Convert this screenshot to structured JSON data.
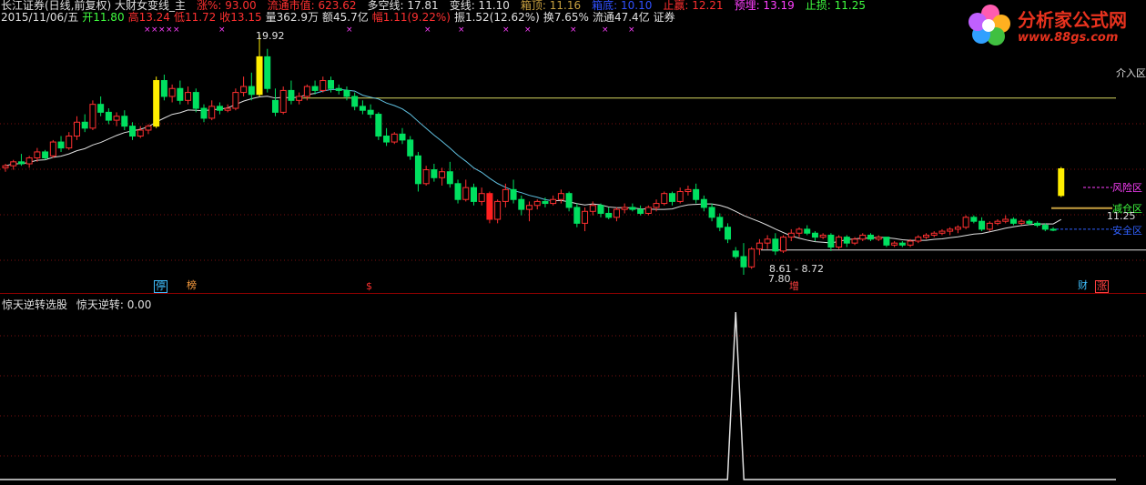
{
  "header": {
    "line1": [
      {
        "text": "长江证券(日线,前复权) 大财女变线_主",
        "color": "#e0e0e0"
      },
      {
        "text": "涨%: 93.00",
        "color": "#ff3030"
      },
      {
        "text": "流通市值: 623.62",
        "color": "#ff3030"
      },
      {
        "text": "多空线: 17.81",
        "color": "#e0e0e0"
      },
      {
        "text": "变线: 11.10",
        "color": "#e0e0e0"
      },
      {
        "text": "箱顶: 11.16",
        "color": "#c8a040"
      },
      {
        "text": "箱底: 10.10",
        "color": "#3050ff"
      },
      {
        "text": "止赢: 12.21",
        "color": "#ff3030"
      },
      {
        "text": "预埋: 13.19",
        "color": "#ff40ff"
      },
      {
        "text": "止损: 11.25",
        "color": "#40ff40"
      }
    ],
    "line2": [
      {
        "text": "2015/11/06/五",
        "color": "#e0e0e0"
      },
      {
        "text": "开11.80",
        "color": "#40ff40"
      },
      {
        "text": "高13.24",
        "color": "#ff3030"
      },
      {
        "text": "低11.72",
        "color": "#ff3030"
      },
      {
        "text": "收13.15",
        "color": "#ff3030"
      },
      {
        "text": "量362.9万",
        "color": "#e0e0e0"
      },
      {
        "text": "额45.7亿",
        "color": "#e0e0e0"
      },
      {
        "text": "幅1.11(9.22%)",
        "color": "#ff3030"
      },
      {
        "text": "振1.52(12.62%)",
        "color": "#e0e0e0"
      },
      {
        "text": "换7.65%",
        "color": "#e0e0e0"
      },
      {
        "text": "流通47.4亿",
        "color": "#e0e0e0"
      },
      {
        "text": "证券",
        "color": "#e0e0e0"
      }
    ]
  },
  "logo": {
    "title": "分析家公式网",
    "url": "www.88gs.com"
  },
  "annotations": {
    "high_label": "19.92",
    "low_label": "7.80",
    "range_label": "8.61 - 8.72",
    "entry_label": "介入区",
    "risk_label": "风险区",
    "sell_label": "减仓区",
    "safe_label": "安全区",
    "price_tag": "11.25"
  },
  "tags": [
    {
      "text": "停",
      "color": "#40c0ff"
    },
    {
      "text": "榜",
      "color": "#ffa040"
    },
    {
      "text": "$",
      "color": "#ff3030"
    },
    {
      "text": "增",
      "color": "#ff4040"
    },
    {
      "text": "财",
      "color": "#40c0ff"
    },
    {
      "text": "涨",
      "color": "#ff4040"
    }
  ],
  "sub_panel": {
    "title": "惊天逆转选股",
    "value_label": "惊天逆转: 0.00"
  },
  "chart_data": {
    "type": "candlestick",
    "price_range": [
      7.8,
      19.92
    ],
    "candles": [
      [
        13.2,
        13.4,
        13.0,
        13.3
      ],
      [
        13.3,
        13.6,
        13.1,
        13.5
      ],
      [
        13.5,
        13.9,
        13.3,
        13.4
      ],
      [
        13.4,
        13.8,
        13.2,
        13.7
      ],
      [
        13.7,
        14.2,
        13.5,
        14.0
      ],
      [
        14.0,
        14.1,
        13.6,
        13.7
      ],
      [
        13.8,
        14.6,
        13.7,
        14.5
      ],
      [
        14.5,
        14.8,
        14.0,
        14.2
      ],
      [
        14.2,
        15.0,
        14.1,
        14.8
      ],
      [
        14.8,
        15.8,
        14.6,
        15.5
      ],
      [
        15.5,
        15.9,
        15.0,
        15.2
      ],
      [
        15.2,
        16.6,
        15.1,
        16.4
      ],
      [
        16.4,
        16.8,
        15.8,
        16.0
      ],
      [
        16.0,
        16.2,
        15.4,
        15.6
      ],
      [
        15.6,
        16.0,
        15.3,
        15.8
      ],
      [
        15.8,
        16.1,
        15.1,
        15.3
      ],
      [
        15.3,
        15.5,
        14.6,
        14.8
      ],
      [
        14.8,
        15.3,
        14.7,
        15.1
      ],
      [
        15.1,
        15.4,
        14.9,
        15.3
      ],
      [
        15.3,
        17.8,
        15.2,
        17.6
      ],
      [
        17.6,
        17.9,
        16.6,
        16.8
      ],
      [
        16.8,
        17.4,
        16.5,
        17.2
      ],
      [
        17.2,
        17.6,
        16.4,
        16.6
      ],
      [
        16.6,
        17.3,
        16.4,
        17.0
      ],
      [
        17.0,
        17.2,
        16.0,
        16.2
      ],
      [
        16.2,
        16.4,
        15.5,
        15.7
      ],
      [
        15.7,
        16.6,
        15.6,
        16.3
      ],
      [
        16.3,
        16.5,
        15.9,
        16.1
      ],
      [
        16.1,
        16.4,
        16.0,
        16.2
      ],
      [
        16.2,
        17.2,
        16.1,
        17.0
      ],
      [
        17.0,
        17.8,
        16.8,
        17.3
      ],
      [
        17.3,
        18.0,
        16.6,
        16.9
      ],
      [
        16.9,
        19.92,
        16.8,
        18.8
      ],
      [
        18.8,
        19.2,
        17.0,
        17.2
      ],
      [
        16.6,
        17.2,
        15.8,
        16.0
      ],
      [
        16.0,
        17.3,
        15.9,
        17.1
      ],
      [
        17.1,
        17.6,
        16.4,
        16.6
      ],
      [
        16.6,
        17.0,
        16.4,
        16.8
      ],
      [
        16.8,
        17.4,
        16.6,
        17.3
      ],
      [
        17.3,
        17.6,
        16.9,
        17.1
      ],
      [
        17.1,
        17.8,
        17.0,
        17.6
      ],
      [
        17.6,
        17.8,
        17.0,
        17.2
      ],
      [
        17.2,
        17.4,
        16.9,
        17.1
      ],
      [
        17.1,
        17.3,
        16.6,
        16.8
      ],
      [
        16.8,
        17.0,
        16.1,
        16.3
      ],
      [
        16.3,
        16.6,
        15.9,
        16.1
      ],
      [
        16.1,
        16.4,
        15.7,
        15.9
      ],
      [
        15.9,
        16.0,
        14.6,
        14.8
      ],
      [
        14.8,
        15.2,
        14.3,
        14.5
      ],
      [
        14.5,
        15.0,
        14.4,
        14.9
      ],
      [
        14.9,
        15.2,
        14.4,
        14.6
      ],
      [
        14.6,
        14.8,
        13.6,
        13.8
      ],
      [
        13.8,
        14.0,
        12.0,
        12.4
      ],
      [
        12.4,
        13.3,
        12.3,
        13.1
      ],
      [
        13.1,
        13.4,
        12.5,
        12.7
      ],
      [
        12.7,
        13.2,
        12.3,
        13.0
      ],
      [
        13.0,
        13.5,
        12.2,
        12.4
      ],
      [
        12.4,
        12.6,
        11.4,
        11.6
      ],
      [
        11.6,
        12.6,
        11.5,
        12.2
      ],
      [
        12.2,
        12.4,
        11.3,
        11.5
      ],
      [
        11.5,
        12.2,
        11.3,
        11.9
      ],
      [
        11.9,
        12.0,
        10.4,
        10.6
      ],
      [
        10.6,
        11.6,
        10.4,
        11.5
      ],
      [
        11.5,
        12.4,
        11.2,
        12.1
      ],
      [
        12.1,
        12.6,
        11.4,
        11.6
      ],
      [
        11.6,
        11.8,
        10.8,
        11.1
      ],
      [
        11.1,
        11.5,
        10.5,
        11.3
      ],
      [
        11.3,
        11.6,
        11.1,
        11.5
      ],
      [
        11.5,
        11.7,
        11.2,
        11.4
      ],
      [
        11.4,
        11.8,
        11.3,
        11.6
      ],
      [
        11.6,
        12.1,
        11.4,
        11.9
      ],
      [
        11.9,
        12.0,
        11.0,
        11.2
      ],
      [
        11.2,
        11.4,
        10.2,
        10.4
      ],
      [
        10.4,
        11.2,
        10.0,
        11.0
      ],
      [
        11.0,
        11.5,
        10.8,
        11.3
      ],
      [
        11.3,
        11.4,
        10.7,
        10.9
      ],
      [
        10.9,
        11.2,
        10.6,
        10.7
      ],
      [
        10.7,
        11.2,
        10.5,
        11.1
      ],
      [
        11.1,
        11.4,
        10.9,
        11.2
      ],
      [
        11.2,
        11.4,
        11.0,
        11.1
      ],
      [
        11.1,
        11.3,
        10.8,
        10.9
      ],
      [
        10.9,
        11.3,
        10.8,
        11.2
      ],
      [
        11.2,
        11.6,
        11.0,
        11.4
      ],
      [
        11.4,
        12.0,
        11.3,
        11.9
      ],
      [
        11.9,
        12.0,
        11.3,
        11.5
      ],
      [
        11.5,
        12.2,
        11.4,
        12.0
      ],
      [
        12.0,
        12.3,
        11.8,
        12.1
      ],
      [
        12.1,
        12.4,
        11.4,
        11.6
      ],
      [
        11.6,
        11.8,
        11.0,
        11.2
      ],
      [
        11.2,
        11.4,
        10.5,
        10.7
      ],
      [
        10.7,
        10.9,
        10.0,
        10.2
      ],
      [
        10.2,
        10.4,
        9.4,
        9.6
      ],
      [
        9.0,
        9.2,
        8.61,
        8.72
      ],
      [
        8.72,
        9.4,
        7.8,
        8.2
      ],
      [
        8.2,
        9.2,
        8.1,
        9.1
      ],
      [
        9.1,
        9.6,
        8.8,
        9.4
      ],
      [
        9.4,
        9.8,
        9.1,
        9.6
      ],
      [
        9.6,
        9.9,
        8.8,
        9.0
      ],
      [
        9.0,
        9.8,
        8.9,
        9.7
      ],
      [
        9.7,
        10.1,
        9.5,
        9.9
      ],
      [
        9.9,
        10.2,
        9.7,
        10.1
      ],
      [
        10.1,
        10.3,
        9.8,
        9.9
      ],
      [
        9.9,
        10.0,
        9.5,
        9.7
      ],
      [
        9.7,
        9.9,
        9.6,
        9.8
      ],
      [
        9.8,
        9.9,
        9.0,
        9.2
      ],
      [
        9.2,
        9.8,
        9.1,
        9.7
      ],
      [
        9.7,
        9.8,
        9.2,
        9.4
      ],
      [
        9.4,
        9.7,
        9.3,
        9.6
      ],
      [
        9.6,
        9.9,
        9.5,
        9.8
      ],
      [
        9.8,
        9.9,
        9.5,
        9.6
      ],
      [
        9.6,
        9.8,
        9.5,
        9.7
      ],
      [
        9.7,
        9.7,
        9.2,
        9.3
      ],
      [
        9.3,
        9.5,
        9.2,
        9.4
      ],
      [
        9.4,
        9.5,
        9.2,
        9.3
      ],
      [
        9.3,
        9.6,
        9.2,
        9.5
      ],
      [
        9.5,
        9.8,
        9.4,
        9.7
      ],
      [
        9.7,
        9.9,
        9.6,
        9.8
      ],
      [
        9.8,
        10.0,
        9.7,
        9.9
      ],
      [
        9.9,
        10.1,
        9.8,
        10.0
      ],
      [
        10.0,
        10.2,
        9.8,
        10.1
      ],
      [
        10.1,
        10.3,
        9.9,
        10.2
      ],
      [
        10.2,
        10.8,
        10.1,
        10.7
      ],
      [
        10.7,
        10.8,
        10.4,
        10.5
      ],
      [
        10.5,
        10.7,
        10.0,
        10.1
      ],
      [
        10.1,
        10.5,
        10.0,
        10.4
      ],
      [
        10.4,
        10.6,
        10.3,
        10.5
      ],
      [
        10.5,
        10.8,
        10.4,
        10.6
      ],
      [
        10.6,
        10.7,
        10.3,
        10.4
      ],
      [
        10.4,
        10.6,
        10.3,
        10.5
      ],
      [
        10.5,
        10.6,
        10.3,
        10.4
      ],
      [
        10.4,
        10.5,
        10.2,
        10.3
      ],
      [
        10.3,
        10.4,
        10.0,
        10.1
      ],
      [
        10.1,
        10.2,
        10.0,
        10.05
      ],
      [
        11.8,
        13.24,
        11.72,
        13.15
      ]
    ],
    "entry_price": 16.72,
    "risk_price": 12.21,
    "sell_price": 11.16,
    "safe_price": 10.1,
    "support_price": 9.05,
    "signal_peak_index": 92
  }
}
